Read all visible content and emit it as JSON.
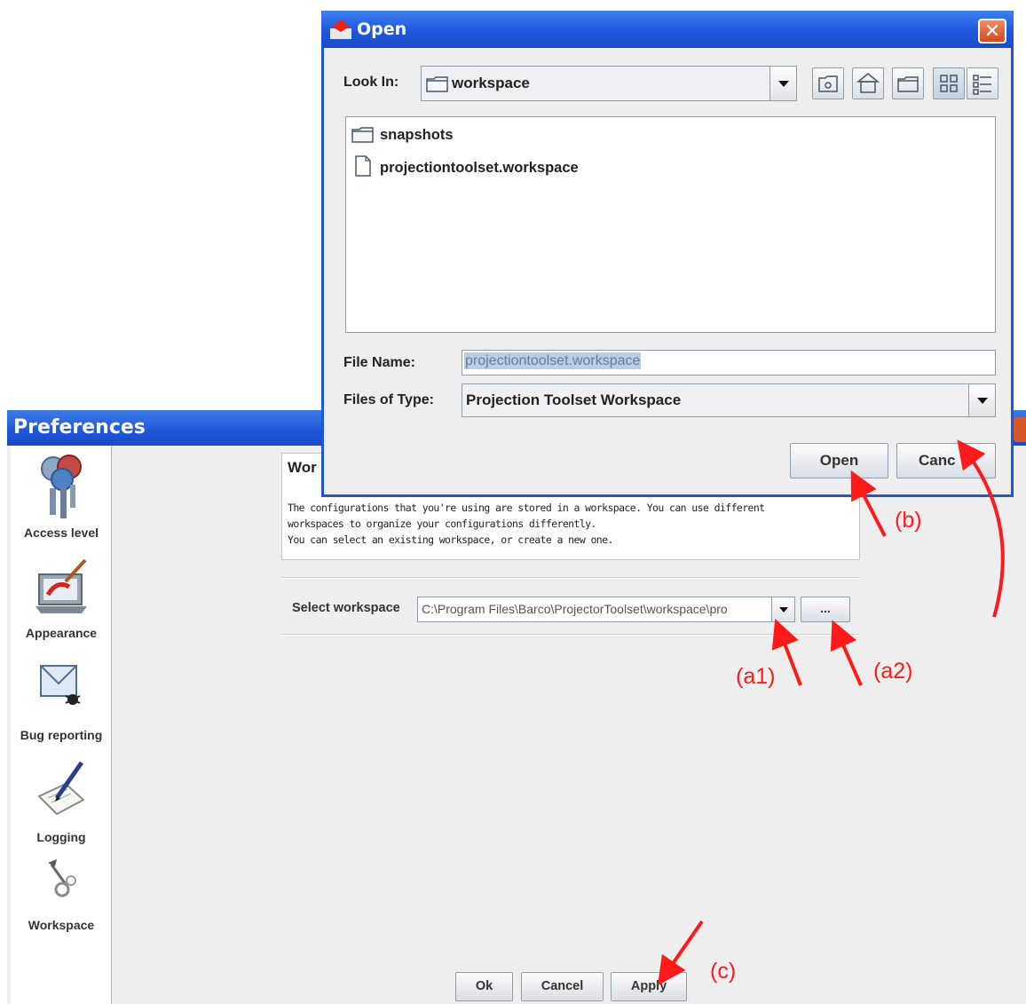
{
  "preferences": {
    "title": "Preferences",
    "sidebar": [
      {
        "label": "Access level",
        "icon": "keys-icon"
      },
      {
        "label": "Appearance",
        "icon": "palette-laptop-icon"
      },
      {
        "label": "Bug reporting",
        "icon": "envelope-bug-icon"
      },
      {
        "label": "Logging",
        "icon": "notepad-pen-icon"
      },
      {
        "label": "Workspace",
        "icon": "tools-gear-icon"
      }
    ],
    "panel": {
      "heading": "Wor",
      "description_line1": "The configurations that you're using are stored in a workspace. You can use different",
      "description_line2": "workspaces to organize your configurations differently.",
      "description_line3": "You can select an existing workspace, or create a new one.",
      "select_label": "Select workspace",
      "workspace_value": "C:\\Program Files\\Barco\\ProjectorToolset\\workspace\\pro",
      "browse_label": "..."
    },
    "buttons": {
      "ok": "Ok",
      "cancel": "Cancel",
      "apply": "Apply"
    }
  },
  "open_dialog": {
    "title": "Open",
    "look_in_label": "Look In:",
    "look_in_value": "workspace",
    "files": [
      {
        "name": "snapshots",
        "type": "folder"
      },
      {
        "name": "projectiontoolset.workspace",
        "type": "file"
      }
    ],
    "file_name_label": "File Name:",
    "file_name_value": "projectiontoolset.workspace",
    "files_of_type_label": "Files of Type:",
    "files_of_type_value": "Projection Toolset Workspace",
    "open_button": "Open",
    "cancel_button": "Canc",
    "close_symbol": "✕"
  },
  "annotations": {
    "b": "(b)",
    "a1": "(a1)",
    "a2": "(a2)",
    "c": "(c)"
  },
  "colors": {
    "title_bar": "#1f56d8",
    "annotation": "#ff1a1a"
  }
}
